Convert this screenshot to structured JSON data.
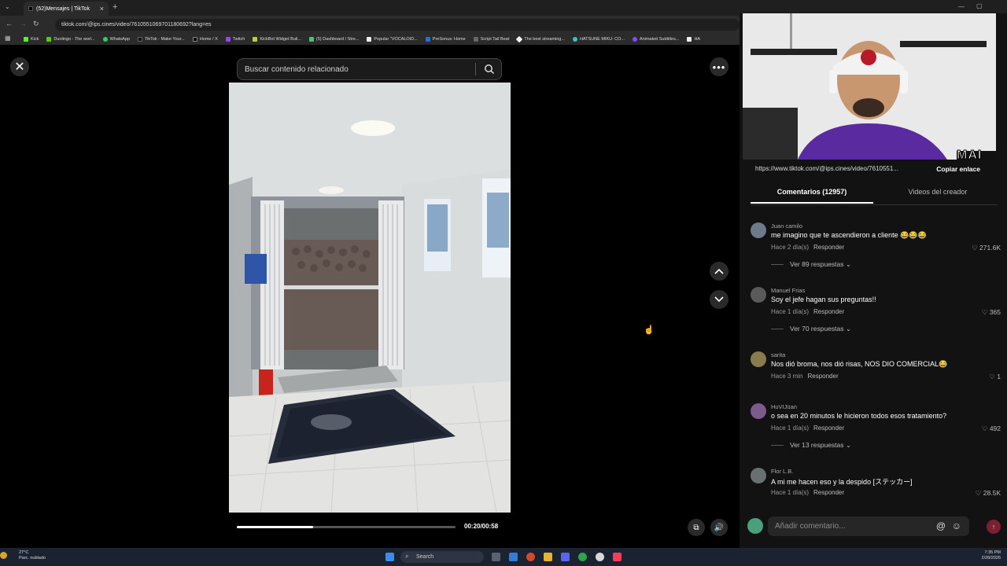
{
  "browser": {
    "tab_title": "(52)Mensajes | TikTok",
    "url": "tiktok.com/@ips.cines/video/7610551069701180692?lang=es",
    "bookmarks": [
      "Kick",
      "Duolingo - The worl...",
      "WhatsApp",
      "TikTok - Make Your...",
      "Home / X",
      "Twitch",
      "KickBot Widget Buil...",
      "(5) Dashboard / Stre...",
      "Popular \"VOCALOID...",
      "PreSonus: Home",
      "Script Tail Beat",
      "The best streaming...",
      "HATSUNE MIKU: CO...",
      "Animated Subtitles...",
      "HA"
    ]
  },
  "player": {
    "search_placeholder": "Buscar contenido relacionado",
    "time": "00:20/00:58",
    "progress": 0.35
  },
  "panel": {
    "overlay_logo": "MAI",
    "share_link": "https://www.tiktok.com/@ips.cines/video/7610551...",
    "copy_label": "Copiar enlace",
    "tab_comments": "Comentarios (12957)",
    "tab_creator": "Videos del creador",
    "comment_placeholder": "Añadir comentario...",
    "reply_label": "Responder",
    "comments": [
      {
        "user": "Juan camilo",
        "text": "me imagino que te ascendieron a cliente 😂😂😂",
        "time": "Hace 2 día(s)",
        "likes": "271.6K",
        "replies": "Ver 89 respuestas"
      },
      {
        "user": "Manuel Frias",
        "text": "Soy el jefe hagan sus preguntas!!",
        "time": "Hace 1 día(s)",
        "likes": "365",
        "replies": "Ver 70 respuestas"
      },
      {
        "user": "sarita",
        "text": "Nos dió broma, nos dió risas, NOS DIO COMERCIAL😂",
        "time": "Hace 3 min",
        "likes": "1",
        "replies": ""
      },
      {
        "user": "HuVIJüan",
        "text": "o sea en 20 minutos le hicieron todos esos tratamiento?",
        "time": "Hace 1 día(s)",
        "likes": "492",
        "replies": "Ver 13 respuestas"
      },
      {
        "user": "Flor L.B.",
        "text": "A mi me hacen eso y la despido [ステッカー]",
        "time": "Hace 1 día(s)",
        "likes": "28.5K",
        "replies": ""
      }
    ]
  },
  "taskbar": {
    "weather_temp": "27°C",
    "weather_desc": "Parc. nublado",
    "search_label": "Search",
    "time": "7:35 PM",
    "date": "2/28/2026"
  }
}
